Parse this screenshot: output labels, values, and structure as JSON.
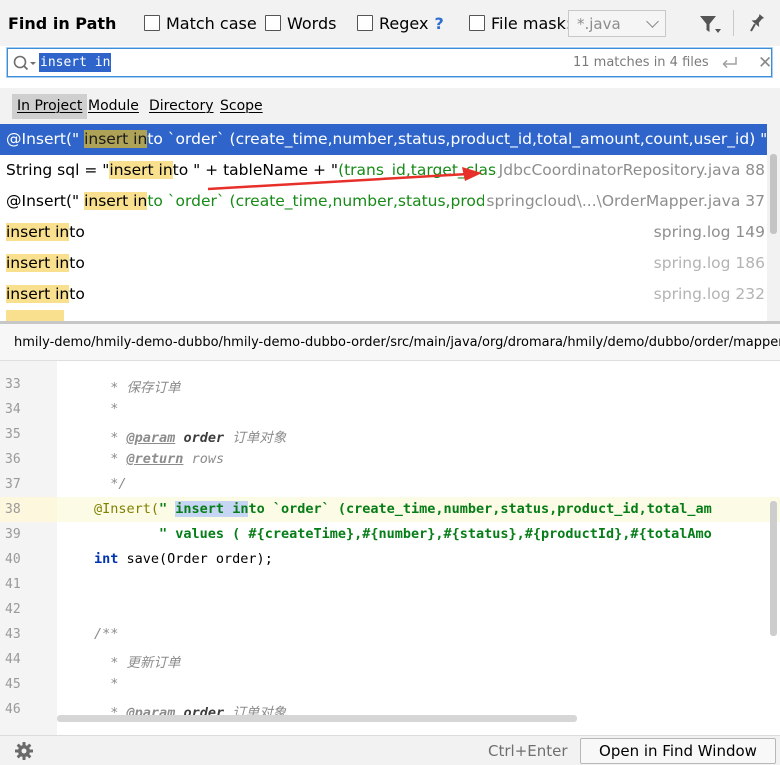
{
  "header": {
    "title": "Find in Path",
    "options": {
      "match_case": "Match case",
      "words": "Words",
      "regex": "Regex",
      "regex_help": "?",
      "file_mask": "File mask:",
      "file_mask_value": "*.java"
    },
    "icons": {
      "filter": "filter-icon",
      "pin": "pin-icon"
    }
  },
  "search": {
    "query": "insert in",
    "matches": "11 matches in 4 files"
  },
  "scope_tabs": [
    "In Project",
    "Module",
    "Directory",
    "Scope"
  ],
  "results": [
    {
      "pre": "@Insert(\" ",
      "match": "insert in",
      "post": "to `order` (create_time,number,status,product_id,total_amount,count,user_id) \" + dubbo",
      "location": ""
    },
    {
      "pre": "String sql = \"",
      "match": "insert in",
      "post_code": "to \" + tableName + \"",
      "post_str": "(trans_id,target_class,targe",
      "location": "JdbcCoordinatorRepository.java 88"
    },
    {
      "pre": "@Insert(\" ",
      "match": "insert in",
      "post_str": "to `order` (create_time,number,status,product_id,",
      "location": "springcloud\\...\\OrderMapper.java 37"
    },
    {
      "match": "insert in",
      "post": "to",
      "location": "spring.log 149"
    },
    {
      "match": "insert in",
      "post": "to",
      "location": "spring.log 186"
    },
    {
      "match": "insert in",
      "post": "to",
      "location": "spring.log 232"
    }
  ],
  "path": "hmily-demo/hmily-demo-dubbo/hmily-demo-dubbo-order/src/main/java/org/dromara/hmily/demo/dubbo/order/mapper/",
  "editor": {
    "line_numbers": [
      "33",
      "34",
      "35",
      "36",
      "37",
      "38",
      "39",
      "40",
      "41",
      "42",
      "43",
      "44",
      "45",
      "46"
    ],
    "lines": {
      "l33": "  * 保存订单",
      "l34": "  *",
      "l35_tag": "@param",
      "l35_name": "order",
      "l35_desc": "订单对象",
      "l36_tag": "@return",
      "l36_desc": "rows",
      "l37": "  */",
      "l38_ann": "@Insert(",
      "l38_q": "\" ",
      "l38_hl": "insert in",
      "l38_rest": "to `order` (create_time,number,status,product_id,total_am",
      "l39": "\" values ( #{createTime},#{number},#{status},#{productId},#{totalAmo",
      "l40_kw": "int",
      "l40_rest": " save(Order order);",
      "l43": "/**",
      "l44": "  * 更新订单",
      "l45": "  *",
      "l46_tag": "@param",
      "l46_name": "order",
      "l46_desc": "订单对象"
    }
  },
  "footer": {
    "shortcut": "Ctrl+Enter",
    "open_button": "Open in Find Window"
  },
  "colors": {
    "selection": "#2f65ca",
    "match_highlight": "#f8e08e",
    "string_green": "#178a17",
    "annotation": "#808000",
    "keyword": "#0033b3",
    "arrow_red": "#e8302a"
  }
}
